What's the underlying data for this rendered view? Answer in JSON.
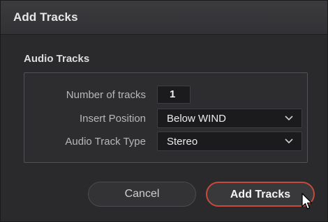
{
  "dialog": {
    "title": "Add Tracks"
  },
  "audio_tracks": {
    "section_label": "Audio Tracks",
    "number_of_tracks_label": "Number of tracks",
    "number_of_tracks_value": "1",
    "insert_position_label": "Insert Position",
    "insert_position_value": "Below WIND",
    "track_type_label": "Audio Track Type",
    "track_type_value": "Stereo"
  },
  "buttons": {
    "cancel_label": "Cancel",
    "add_label": "Add Tracks"
  },
  "colors": {
    "accent_border": "#c94a3a",
    "background": "#2a2a2c",
    "field_background": "#1b1b1d"
  },
  "icons": {
    "dropdown": "chevron-down-icon",
    "pointer": "mouse-cursor-icon"
  }
}
